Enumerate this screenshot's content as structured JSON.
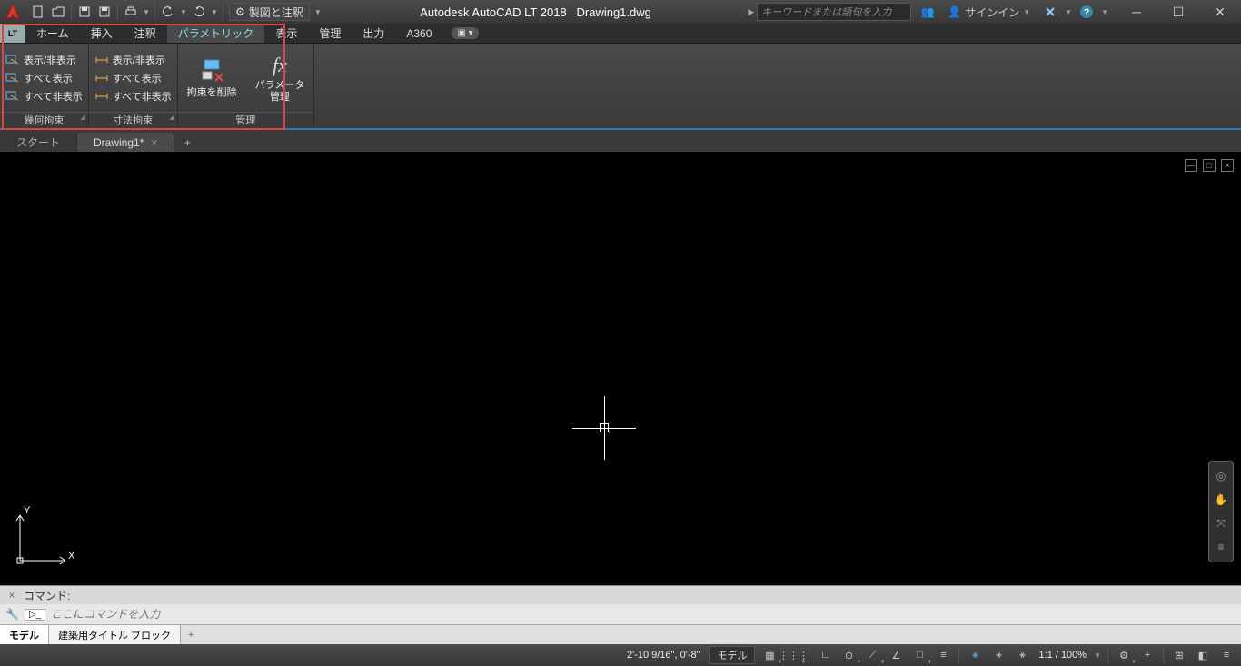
{
  "title": {
    "app": "Autodesk AutoCAD LT 2018",
    "file": "Drawing1.dwg"
  },
  "workspace": {
    "label": "製図と注釈"
  },
  "search": {
    "placeholder": "キーワードまたは語句を入力"
  },
  "signin": {
    "label": "サインイン"
  },
  "menutabs": {
    "lt": "LT",
    "items": [
      "ホーム",
      "挿入",
      "注釈",
      "パラメトリック",
      "表示",
      "管理",
      "出力",
      "A360"
    ],
    "active_index": 3
  },
  "ribbon": {
    "panels": [
      {
        "title": "幾何拘束",
        "buttons": [
          "表示/非表示",
          "すべて表示",
          "すべて非表示"
        ]
      },
      {
        "title": "寸法拘束",
        "buttons": [
          "表示/非表示",
          "すべて表示",
          "すべて非表示"
        ]
      },
      {
        "title": "管理",
        "big_buttons": [
          {
            "label": "拘束を削除",
            "icon": "delete-constraint"
          },
          {
            "label": "パラメータ\n管理",
            "icon": "fx"
          }
        ]
      }
    ]
  },
  "doctabs": {
    "items": [
      {
        "label": "スタート",
        "active": false,
        "closable": false
      },
      {
        "label": "Drawing1*",
        "active": true,
        "closable": true
      }
    ]
  },
  "command": {
    "history_label": "コマンド:",
    "placeholder": "ここにコマンドを入力"
  },
  "layouttabs": {
    "items": [
      "モデル",
      "建築用タイトル ブロック"
    ],
    "active_index": 0
  },
  "status": {
    "coords": "2'-10 9/16\", 0'-8\"",
    "model": "モデル",
    "scale": "1:1 / 100%"
  }
}
